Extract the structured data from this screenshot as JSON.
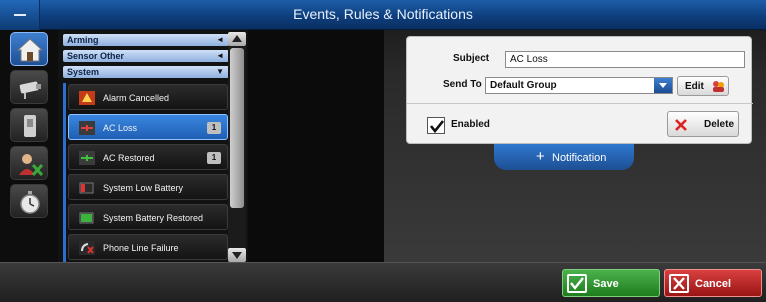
{
  "window": {
    "title": "Events, Rules & Notifications"
  },
  "nav": {
    "items": [
      {
        "icon": "home-icon",
        "active": true
      },
      {
        "icon": "camera-icon",
        "active": false
      },
      {
        "icon": "sensor-icon",
        "active": false
      },
      {
        "icon": "user-remove-icon",
        "active": false
      },
      {
        "icon": "stopwatch-icon",
        "active": false
      }
    ]
  },
  "list": {
    "categories": [
      {
        "label": "Arming",
        "caret": "◄"
      },
      {
        "label": "Sensor Other",
        "caret": "◄"
      },
      {
        "label": "System",
        "caret": "▼"
      }
    ],
    "items": [
      {
        "label": "Alarm Cancelled",
        "badge": "",
        "icon": "alarm-icon"
      },
      {
        "label": "AC Loss",
        "badge": "1",
        "icon": "ac-plug-icon"
      },
      {
        "label": "AC Restored",
        "badge": "1",
        "icon": "ac-plug-icon"
      },
      {
        "label": "System Low Battery",
        "badge": "",
        "icon": "battery-low-icon"
      },
      {
        "label": "System Battery Restored",
        "badge": "",
        "icon": "battery-full-icon"
      },
      {
        "label": "Phone Line Failure",
        "badge": "",
        "icon": "phone-fail-icon"
      }
    ]
  },
  "detail": {
    "subject_label": "Subject",
    "subject_value": "AC Loss",
    "sendto_label": "Send To",
    "sendto_value": "Default Group",
    "edit_label": "Edit",
    "enabled_label": "Enabled",
    "enabled_checked": true,
    "delete_label": "Delete",
    "notification_tab": "Notification"
  },
  "footer": {
    "save_label": "Save",
    "cancel_label": "Cancel"
  },
  "colors": {
    "titlebar": "#0e3f7e",
    "selection": "#2f78cf",
    "save": "#2a8f2a",
    "cancel": "#b82222"
  }
}
